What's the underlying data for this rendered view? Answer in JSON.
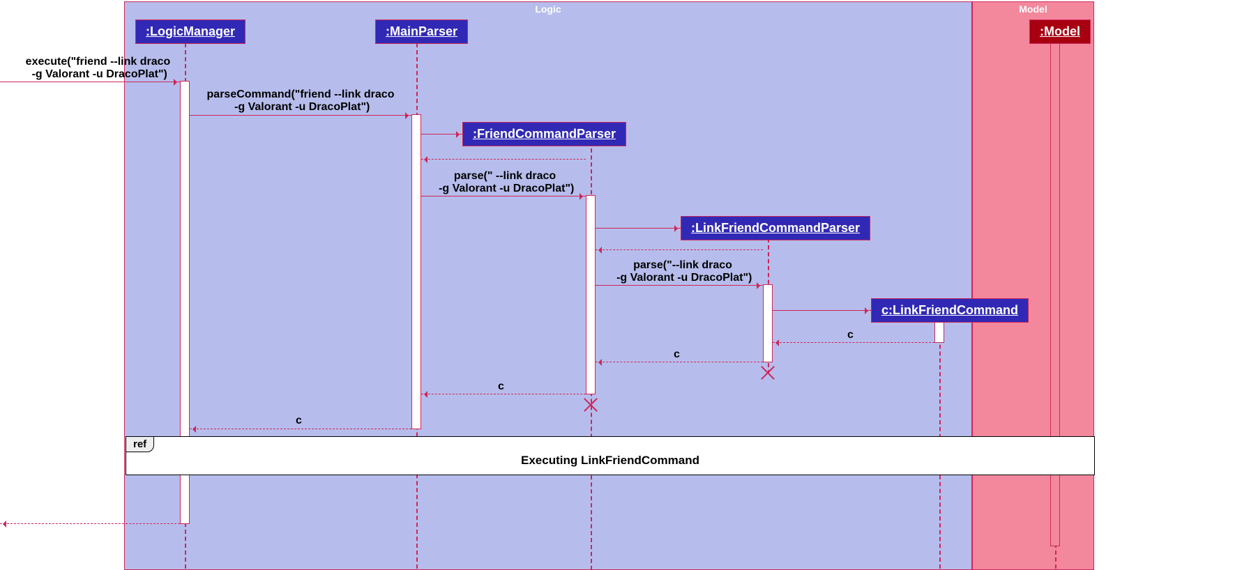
{
  "packages": {
    "logic": "Logic",
    "model": "Model"
  },
  "participants": {
    "logicManager": ":LogicManager",
    "mainParser": ":MainParser",
    "friendCommandParser": ":FriendCommandParser",
    "linkFriendCommandParser": ":LinkFriendCommandParser",
    "linkFriendCommand": "c:LinkFriendCommand",
    "model": ":Model"
  },
  "messages": {
    "execute": "execute(\"friend --link draco\n -g Valorant -u DracoPlat\")",
    "parseCommand": "parseCommand(\"friend --link draco\n -g Valorant -u DracoPlat\")",
    "parse1": "parse(\" --link draco\n -g Valorant -u DracoPlat\")",
    "parse2": "parse(\"--link draco\n -g Valorant -u DracoPlat\")",
    "ret_c1": "c",
    "ret_c2": "c",
    "ret_c3": "c",
    "ret_c4": "c"
  },
  "ref": {
    "label": "ref",
    "text": "Executing LinkFriendCommand"
  }
}
